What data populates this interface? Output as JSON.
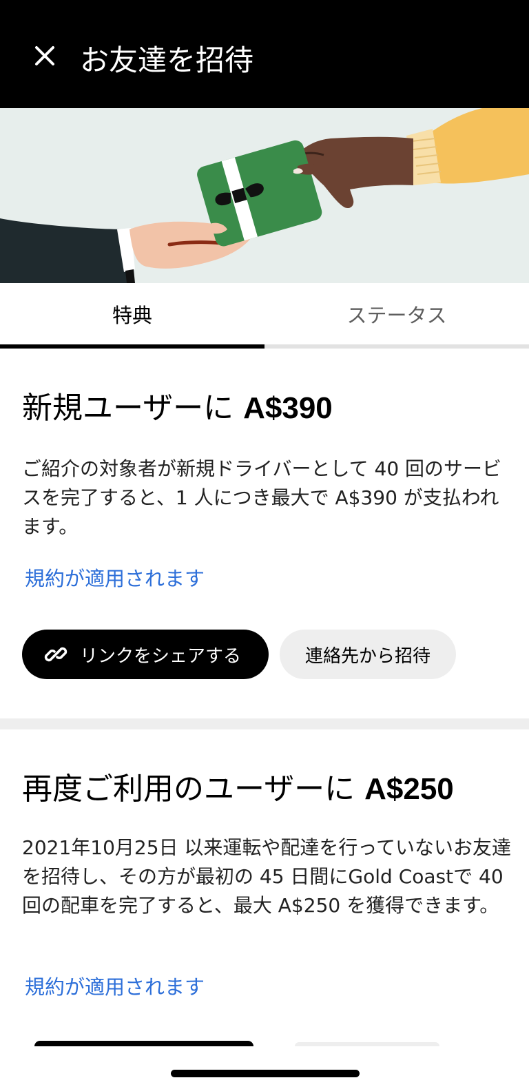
{
  "header": {
    "title": "お友達を招待",
    "close_icon": "close-icon"
  },
  "tabs": [
    {
      "label": "特典",
      "active": true
    },
    {
      "label": "ステータス",
      "active": false
    }
  ],
  "offers": [
    {
      "title_prefix": "新規ユーザーに ",
      "title_amount": "A$390",
      "description": "ご紹介の対象者が新規ドライバーとして 40 回のサービスを完了すると、1 人につき最大で A$390 が支払われます。",
      "terms_link": "規約が適用されます",
      "share_button": "リンクをシェアする",
      "contacts_button": "連絡先から招待"
    },
    {
      "title_prefix": "再度ご利用のユーザーに ",
      "title_amount": "A$250",
      "description": "2021年10月25日 以来運転や配達を行っていないお友達を招待し、その方が最初の 45 日間にGold Coastで 40 回の配車を完了すると、最大 A$250 を獲得できます。",
      "terms_link": "規約が適用されます"
    }
  ],
  "colors": {
    "header_bg": "#000000",
    "hero_bg": "#e7eeec",
    "link": "#2d6fd9",
    "secondary_button": "#eeeeee",
    "gift_green": "#3a8c4a",
    "sleeve_yellow": "#f5c15b"
  }
}
